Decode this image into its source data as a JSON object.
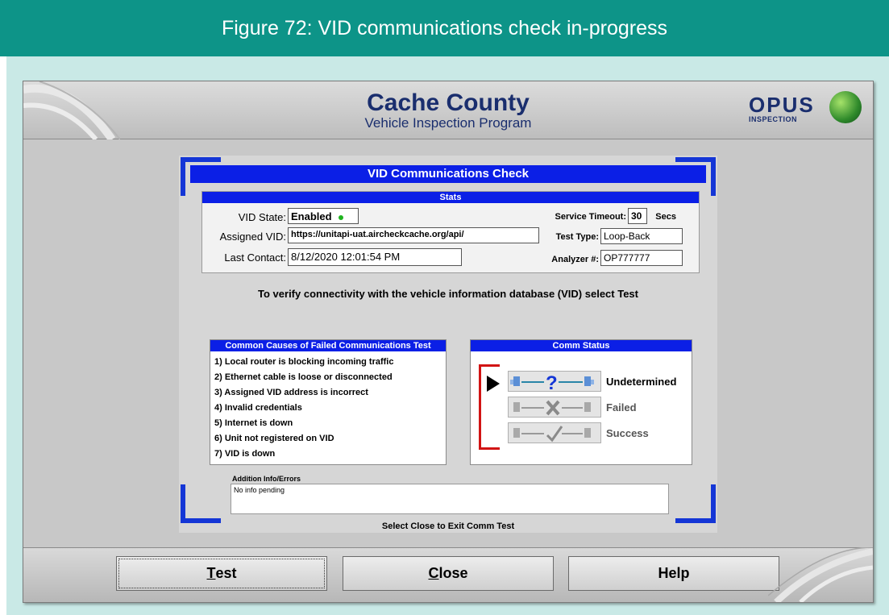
{
  "figure": {
    "caption": "Figure 72: VID communications check in-progress"
  },
  "app": {
    "title": "Cache County",
    "subtitle": "Vehicle Inspection Program",
    "logo_main": "OPUS",
    "logo_sub": "INSPECTION"
  },
  "dialog": {
    "title": "VID Communications Check",
    "stats": {
      "header": "Stats",
      "vid_state_label": "VID State:",
      "vid_state_value": "Enabled",
      "vid_state_color": "#1fb31f",
      "assigned_vid_label": "Assigned VID:",
      "assigned_vid_value": "https://unitapi-uat.aircheckcache.org/api/",
      "last_contact_label": "Last Contact:",
      "last_contact_value": "8/12/2020 12:01:54 PM",
      "service_timeout_label": "Service Timeout:",
      "service_timeout_value": "30",
      "service_timeout_unit": "Secs",
      "test_type_label": "Test Type:",
      "test_type_value": "Loop-Back",
      "analyzer_label": "Analyzer #:",
      "analyzer_value": "OP777777"
    },
    "instruction": "To verify connectivity with the vehicle information database (VID) select Test",
    "causes": {
      "header": "Common Causes of Failed Communications Test",
      "items": [
        "1) Local router is blocking incoming traffic",
        "2) Ethernet cable is loose or disconnected",
        "3) Assigned VID address is incorrect",
        "4) Invalid credentials",
        "5) Internet is down",
        "6) Unit not registered on VID",
        "7) VID is down"
      ]
    },
    "comm_status": {
      "header": "Comm Status",
      "current": "Undetermined",
      "items": [
        {
          "label": "Undetermined",
          "icon": "question-mark-icon",
          "active": true
        },
        {
          "label": "Failed",
          "icon": "x-mark-icon",
          "active": false
        },
        {
          "label": "Success",
          "icon": "checkmark-icon",
          "active": false
        }
      ]
    },
    "addinfo_label": "Addition Info/Errors",
    "addinfo_text": "No info pending",
    "footer_text": "Select Close to Exit Comm Test"
  },
  "buttons": {
    "test_first": "T",
    "test_rest": "est",
    "close_first": "C",
    "close_rest": "lose",
    "help": "Help"
  }
}
